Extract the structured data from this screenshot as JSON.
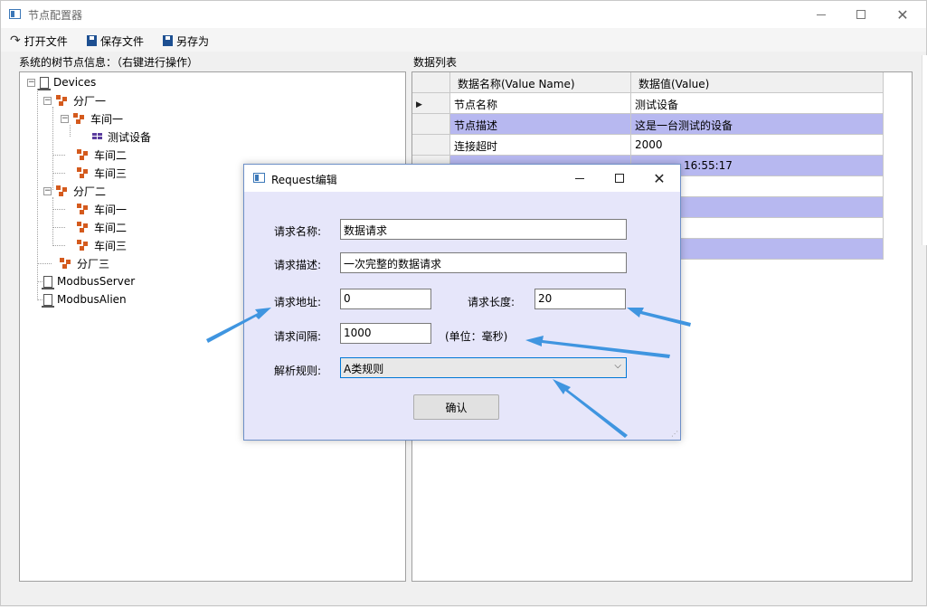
{
  "window": {
    "title": "节点配置器"
  },
  "toolbar": {
    "open_label": "打开文件",
    "save_label": "保存文件",
    "saveas_label": "另存为"
  },
  "tree": {
    "label": "系统的树节点信息：（右键进行操作）",
    "nodes": {
      "devices": "Devices",
      "factory1": "分厂一",
      "ws1_1": "车间一",
      "device1": "测试设备",
      "ws1_2": "车间二",
      "ws1_3": "车间三",
      "factory2": "分厂二",
      "ws2_1": "车间一",
      "ws2_2": "车间二",
      "ws2_3": "车间三",
      "factory3": "分厂三",
      "modbus_server": "ModbusServer",
      "modbus_alien": "ModbusAlien"
    }
  },
  "list": {
    "label": "数据列表",
    "columns": [
      "数据名称(Value Name)",
      "数据值(Value)"
    ],
    "rows": [
      {
        "name": "节点名称",
        "value": "测试设备"
      },
      {
        "name": "节点描述",
        "value": "这是一台测试的设备"
      },
      {
        "name": "连接超时",
        "value": "2000"
      },
      {
        "name": "",
        "value": "16:55:17"
      }
    ]
  },
  "dialog": {
    "title": "Request编辑",
    "name_label": "请求名称:",
    "name_value": "数据请求",
    "desc_label": "请求描述:",
    "desc_value": "一次完整的数据请求",
    "addr_label": "请求地址:",
    "addr_value": "0",
    "length_label": "请求长度:",
    "length_value": "20",
    "interval_label": "请求间隔:",
    "interval_value": "1000",
    "unit_label": "(单位：毫秒)",
    "rule_label": "解析规则:",
    "rule_value": "A类规则",
    "confirm_label": "确认"
  },
  "colors": {
    "selected_row": "#b7b8f0",
    "dialog_bg": "#e6e6fa",
    "arrow": "#3f95e0"
  },
  "icons": [
    "app-icon",
    "redo-icon",
    "floppy-icon",
    "expand-icon",
    "server-icon",
    "workshop-icon",
    "device-icon",
    "chevron-down-icon"
  ]
}
